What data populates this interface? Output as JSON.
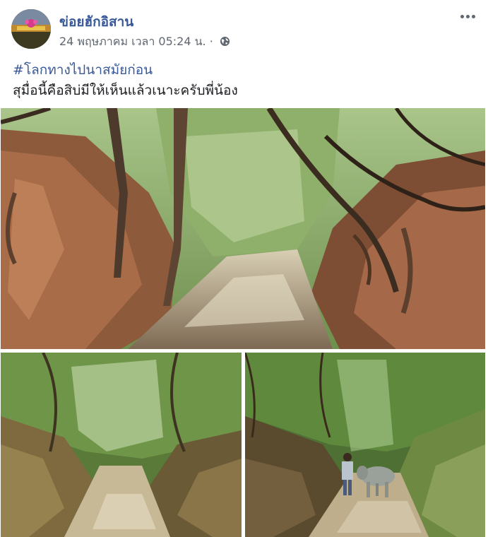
{
  "post": {
    "page_name": "ข่อยฮักอิสาน",
    "timestamp": "24 พฤษภาคม เวลา 05:24 น.",
    "separator": "·",
    "privacy_icon": "globe-icon",
    "more_icon": "ellipsis-icon",
    "hashtag": "#โลกทางไปนาสมัยก่อน",
    "caption": "สุมื่อนี้คือสิบ่มีให้เห็นแล้วเนาะครับพี่น้อง"
  },
  "photos": [
    {
      "subject": "sunken dirt road between eroded red earth banks with twisted tree roots"
    },
    {
      "subject": "shaded sunken path under green canopy"
    },
    {
      "subject": "man leading a buffalo along a sunken path"
    }
  ],
  "colors": {
    "link": "#385898",
    "meta": "#606770",
    "text": "#1c1e21"
  }
}
